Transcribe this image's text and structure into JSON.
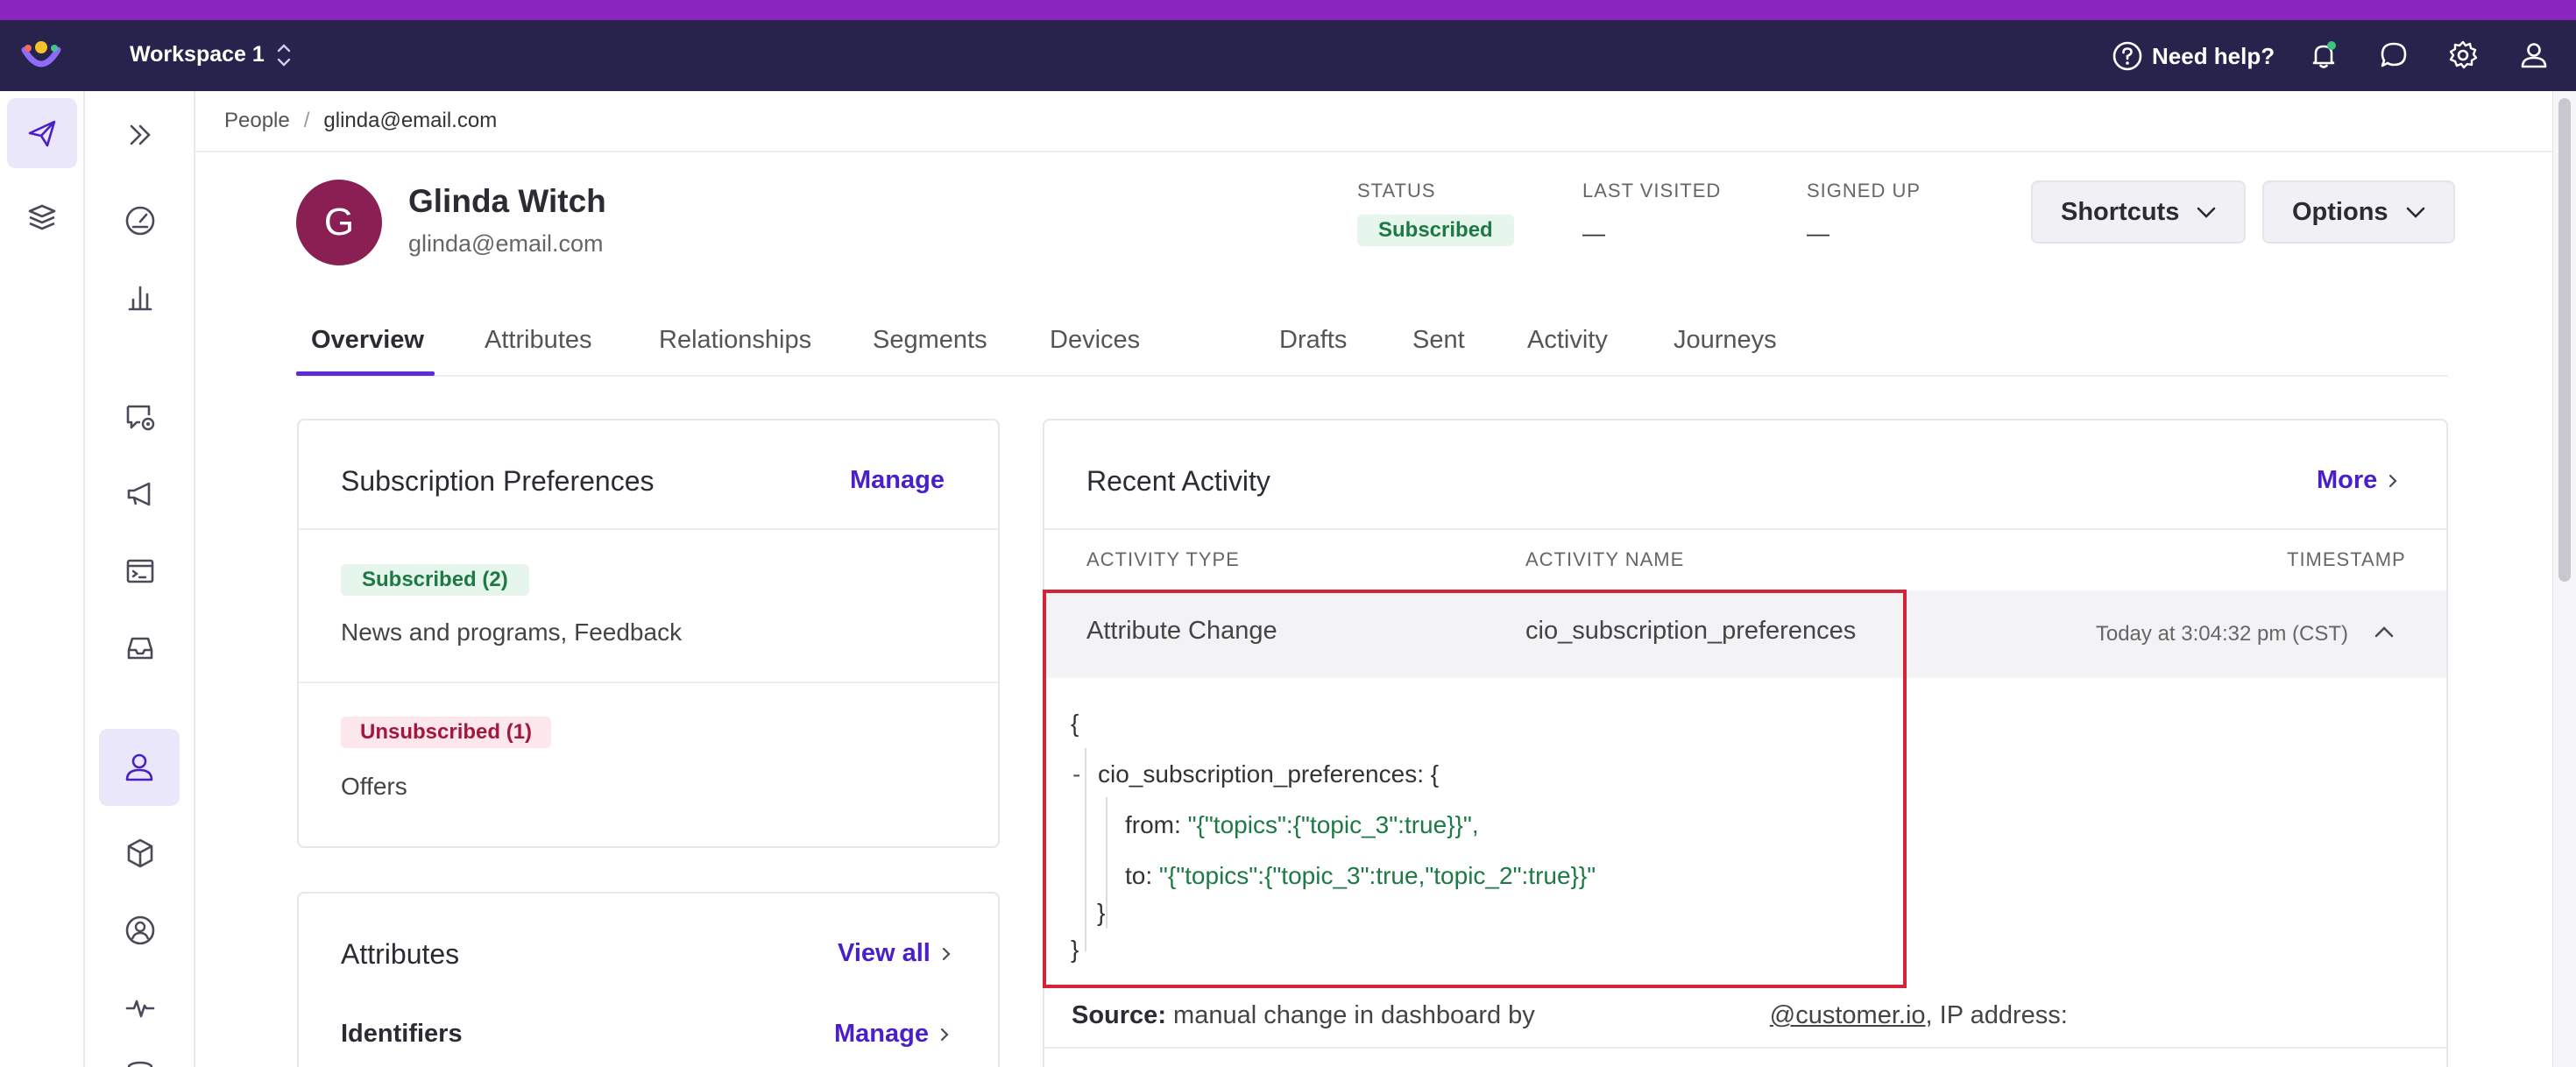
{
  "topbar": {
    "workspace": "Workspace 1",
    "help_label": "Need help?"
  },
  "breadcrumb": {
    "root": "People",
    "separator": "/",
    "current": "glinda@email.com"
  },
  "profile": {
    "initial": "G",
    "name": "Glinda Witch",
    "email": "glinda@email.com",
    "status_label": "STATUS",
    "status_value": "Subscribed",
    "last_visited_label": "LAST VISITED",
    "last_visited_value": "—",
    "signed_up_label": "SIGNED UP",
    "signed_up_value": "—",
    "shortcuts_label": "Shortcuts",
    "options_label": "Options"
  },
  "tabs": [
    "Overview",
    "Attributes",
    "Relationships",
    "Segments",
    "Devices",
    "Drafts",
    "Sent",
    "Activity",
    "Journeys"
  ],
  "subscription": {
    "title": "Subscription Preferences",
    "manage_label": "Manage",
    "subscribed_badge": "Subscribed (2)",
    "subscribed_topics": "News and programs, Feedback",
    "unsubscribed_badge": "Unsubscribed (1)",
    "unsubscribed_topics": "Offers"
  },
  "attributes": {
    "title": "Attributes",
    "view_all_label": "View all",
    "identifiers_label": "Identifiers",
    "manage_label": "Manage"
  },
  "activity": {
    "title": "Recent Activity",
    "more_label": "More",
    "col_type": "ACTIVITY TYPE",
    "col_name": "ACTIVITY NAME",
    "col_timestamp": "TIMESTAMP",
    "row": {
      "type": "Attribute Change",
      "name": "cio_subscription_preferences",
      "timestamp": "Today at 3:04:32 pm (CST)"
    },
    "json": {
      "open_brace": "{",
      "collapse_toggle": "-",
      "key_line": "cio_subscription_preferences: {",
      "from_key": "from:",
      "from_value": "\"{\"topics\":{\"topic_3\":true}}\",",
      "to_key": "to:",
      "to_value": "\"{\"topics\":{\"topic_3\":true,\"topic_2\":true}}\"",
      "inner_close": "}",
      "close_brace": "}"
    },
    "source_label": "Source:",
    "source_text": "manual change in dashboard by",
    "source_email": "@customer.io",
    "source_ip": ", IP address:"
  },
  "colors": {
    "accent": "#4b1fc8",
    "topbar": "#27234d",
    "stripe": "#8a25c0",
    "highlight": "#d3243a"
  }
}
